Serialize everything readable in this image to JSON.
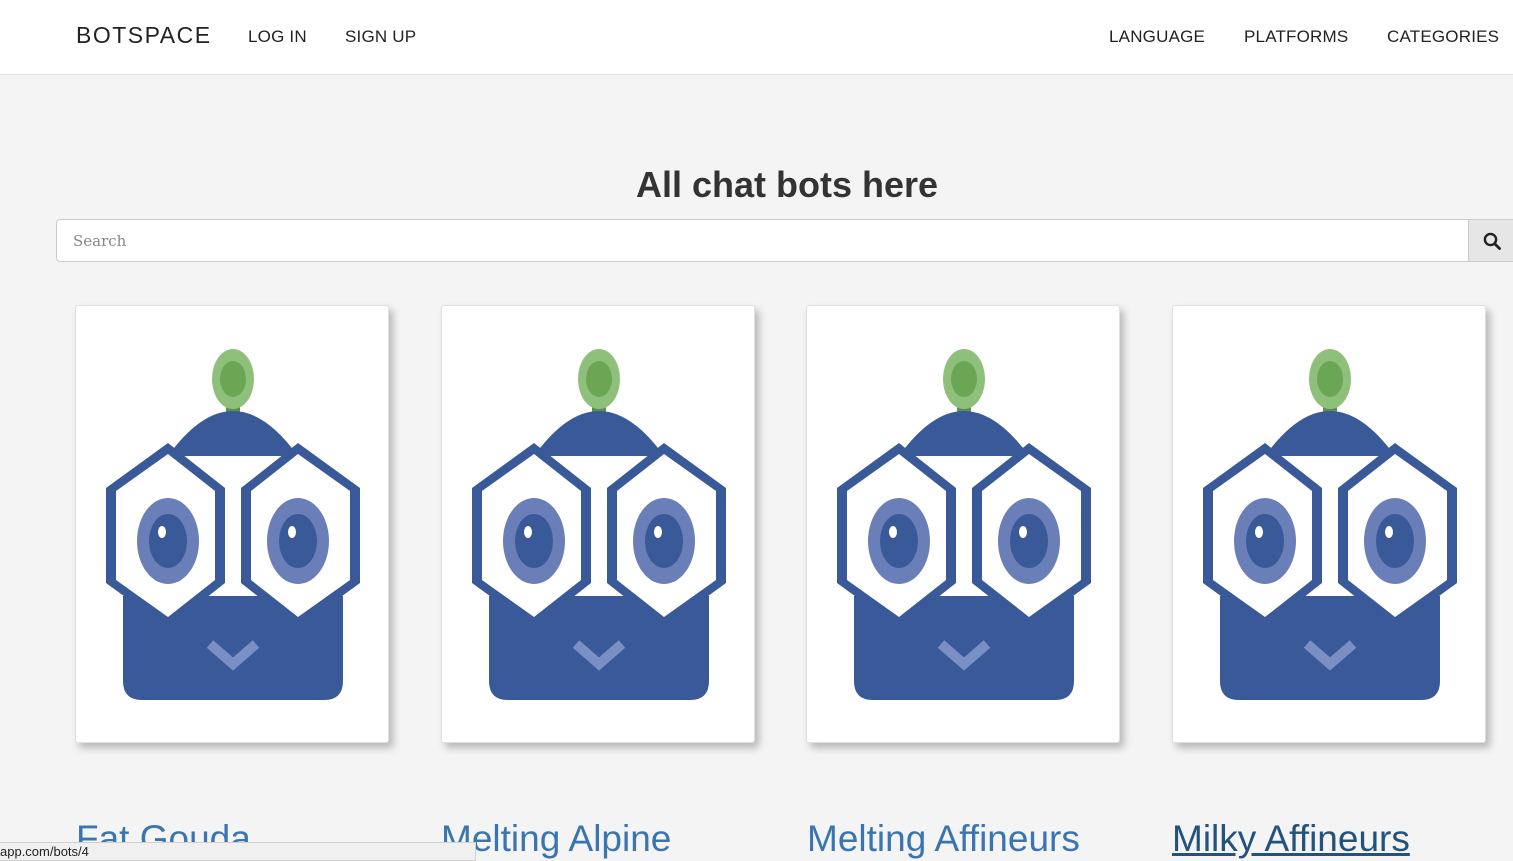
{
  "navbar": {
    "brand": "BOTSPACE",
    "left_links": [
      "LOG IN",
      "SIGN UP"
    ],
    "right_links": [
      "LANGUAGE",
      "PLATFORMS",
      "CATEGORIES"
    ]
  },
  "main": {
    "headline": "All chat bots here",
    "search": {
      "placeholder": "Search",
      "value": ""
    }
  },
  "bots": [
    {
      "name": "Fat Gouda"
    },
    {
      "name": "Melting Alpine"
    },
    {
      "name": "Melting Affineurs"
    },
    {
      "name": "Milky Affineurs"
    }
  ],
  "status_bar": {
    "url": "app.com/bots/4"
  },
  "colors": {
    "link": "#3a75b0",
    "link_hover": "#23527c",
    "bot_body": "#3a5998",
    "bot_eye_ring": "#6a7fb8",
    "bot_antenna": "#7fb56a"
  },
  "icons": {
    "search_button": "magnifier-icon",
    "bot_avatar": "robot-owl-icon"
  }
}
